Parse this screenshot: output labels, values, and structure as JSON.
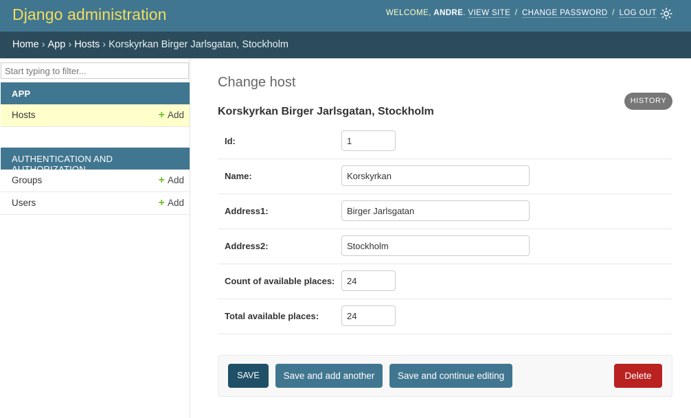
{
  "header": {
    "brand": "Django administration",
    "welcome": "WELCOME,",
    "username": "ANDRE",
    "view_site": "VIEW SITE",
    "change_password": "CHANGE PASSWORD",
    "log_out": "LOG OUT",
    "separator": "/",
    "theme_icon": "sun-icon",
    "brand_color": "#f5dd5d",
    "bar_color": "#417690"
  },
  "breadcrumbs": {
    "home": "Home",
    "app": "App",
    "hosts": "Hosts",
    "current": "Korskyrkan Birger Jarlsgatan, Stockholm",
    "separator": "›"
  },
  "sidebar": {
    "filter_placeholder": "Start typing to filter...",
    "modules": [
      {
        "caption": "App",
        "models": [
          {
            "name": "Hosts",
            "add": "Add"
          }
        ]
      },
      {
        "caption": "Authentication and Authorization",
        "models": [
          {
            "name": "Groups",
            "add": "Add"
          },
          {
            "name": "Users",
            "add": "Add"
          }
        ]
      }
    ]
  },
  "main": {
    "title": "Change host",
    "history": "History",
    "object_title": "Korskyrkan Birger Jarlsgatan, Stockholm",
    "fields": [
      {
        "label": "Id:",
        "value": "1"
      },
      {
        "label": "Name:",
        "value": "Korskyrkan"
      },
      {
        "label": "Address1:",
        "value": "Birger Jarlsgatan"
      },
      {
        "label": "Address2:",
        "value": "Stockholm"
      },
      {
        "label": "Count of available places:",
        "value": "24"
      },
      {
        "label": "Total available places:",
        "value": "24"
      }
    ]
  },
  "submit": {
    "save": "SAVE",
    "save_add_another": "Save and add another",
    "save_continue": "Save and continue editing",
    "delete": "Delete",
    "delete_color": "#ba2121"
  }
}
